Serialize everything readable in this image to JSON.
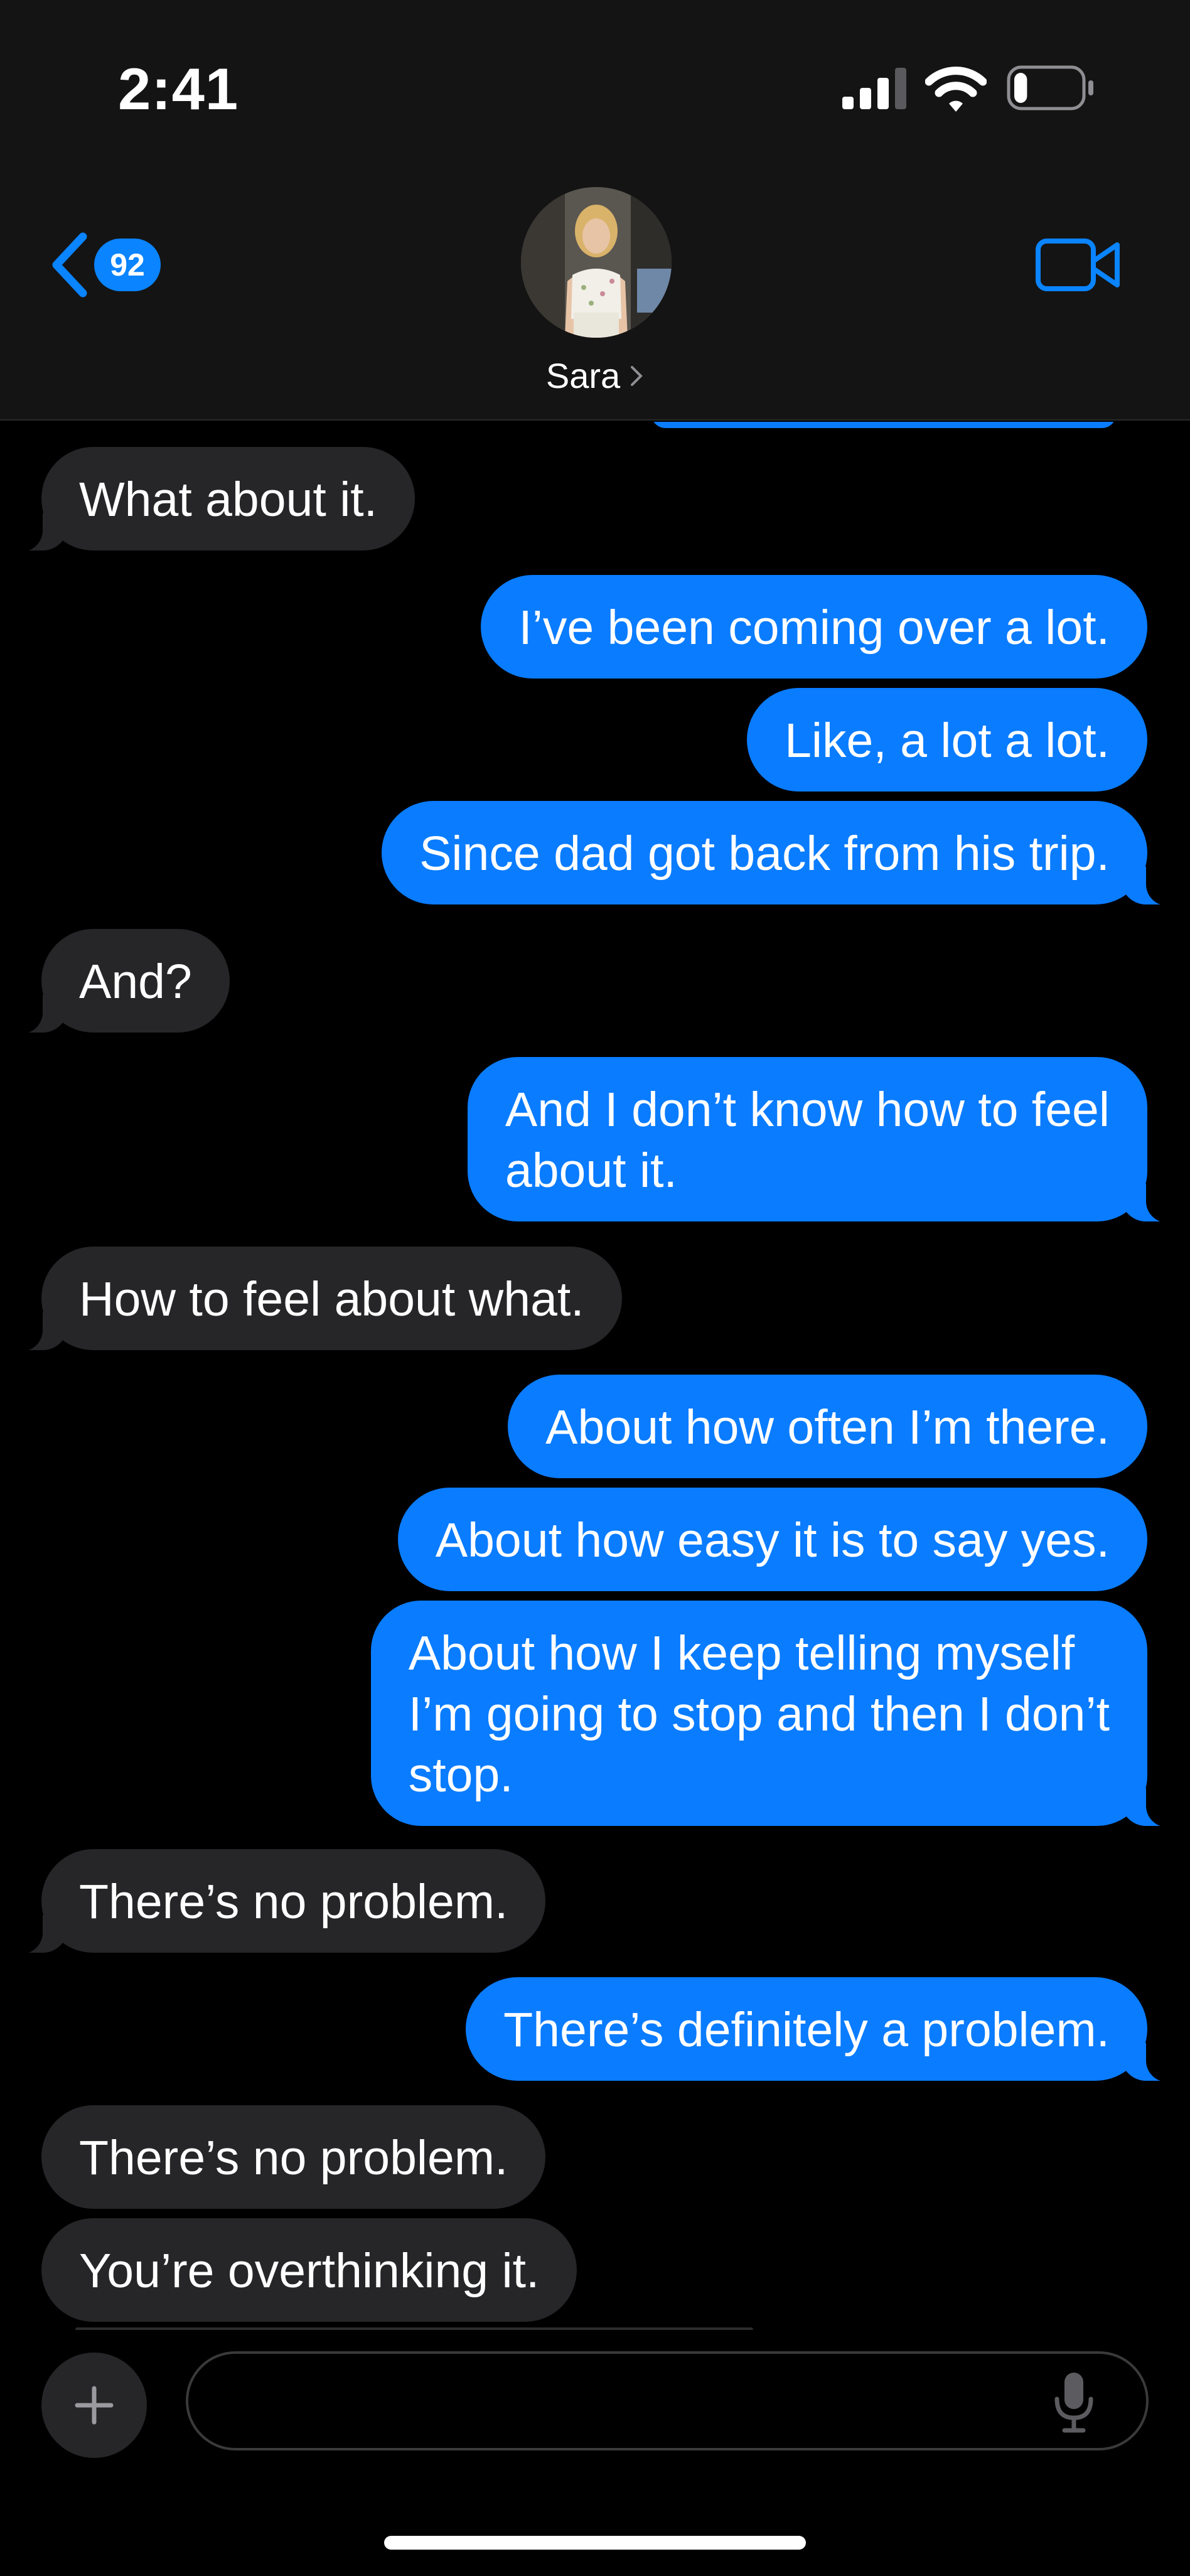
{
  "status_bar": {
    "time": "2:41",
    "signal_icon": "cellular-signal-icon",
    "wifi_icon": "wifi-icon",
    "battery_icon": "battery-low-icon",
    "battery_level": 0.2
  },
  "header": {
    "back_icon": "chevron-left-icon",
    "unread_count": "92",
    "contact_name": "Sara",
    "avatar_icon": "contact-photo",
    "video_icon": "video-camera-icon"
  },
  "messages": [
    {
      "from": "them",
      "text": "What about it."
    },
    {
      "from": "me",
      "text": "I’ve been coming over a lot."
    },
    {
      "from": "me",
      "text": "Like, a lot a lot."
    },
    {
      "from": "me",
      "text": "Since dad got back from his trip."
    },
    {
      "from": "them",
      "text": "And?"
    },
    {
      "from": "me",
      "text": "And I don’t know how to feel\nabout it."
    },
    {
      "from": "them",
      "text": "How to feel about what."
    },
    {
      "from": "me",
      "text": "About how often I’m there."
    },
    {
      "from": "me",
      "text": "About how easy it is to say yes."
    },
    {
      "from": "me",
      "text": "About how I keep telling myself\nI’m going to stop and then I don’t\nstop."
    },
    {
      "from": "them",
      "text": "There’s no problem."
    },
    {
      "from": "me",
      "text": "There’s definitely a problem."
    },
    {
      "from": "them",
      "text": "There’s no problem."
    },
    {
      "from": "them",
      "text": "You’re overthinking it."
    }
  ],
  "composer": {
    "plus_icon": "plus-icon",
    "input_value": "",
    "input_placeholder": "",
    "mic_icon": "microphone-icon"
  },
  "colors": {
    "sent_bubble": "#0a7cff",
    "received_bubble": "#262628",
    "header_bg": "#141414",
    "accent": "#0a84ff"
  }
}
